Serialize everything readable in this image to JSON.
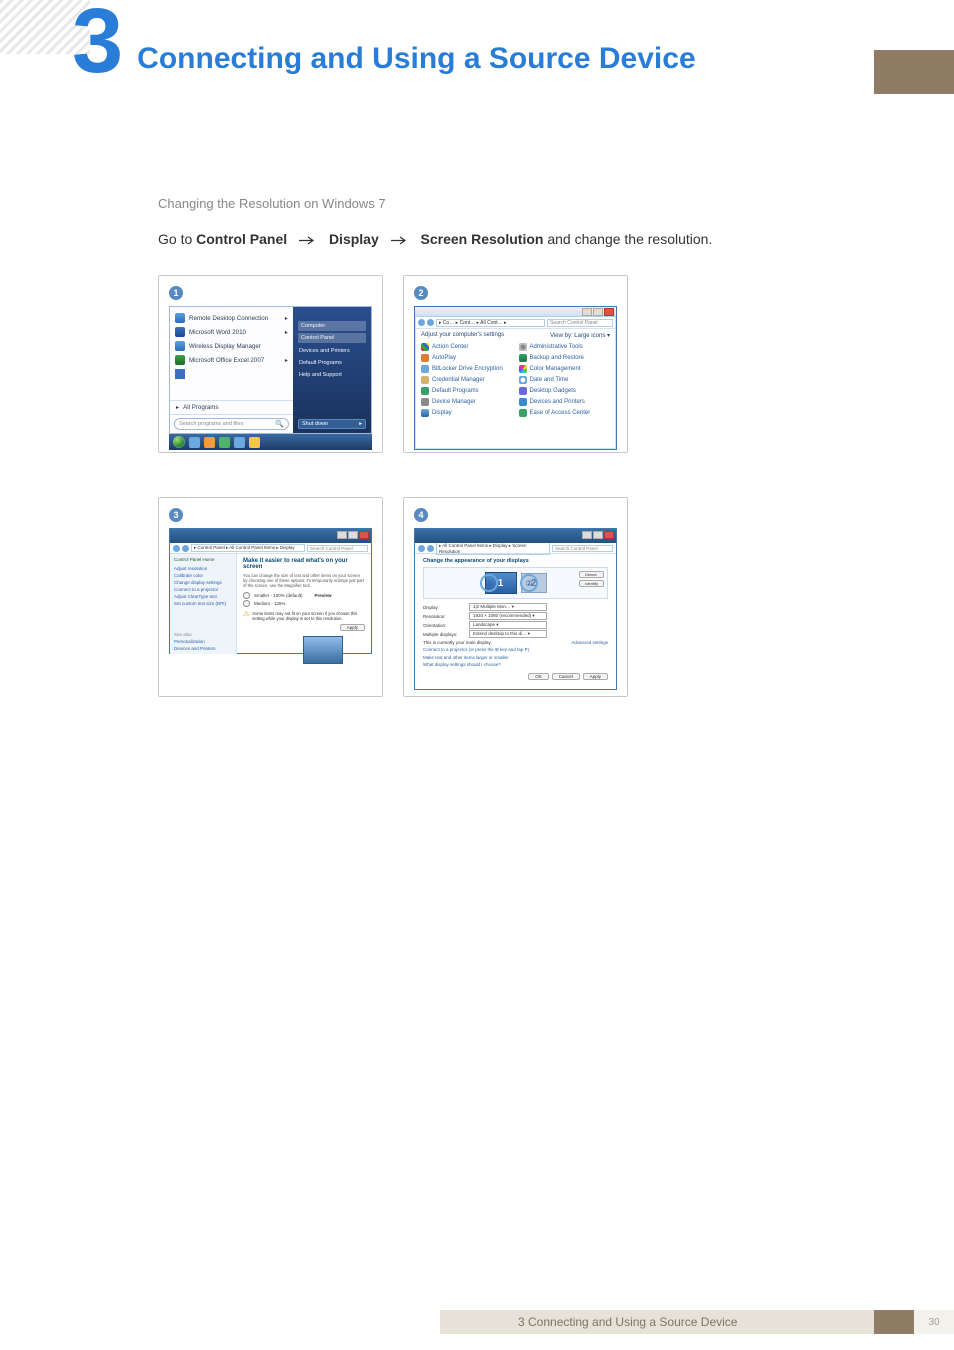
{
  "chapter": {
    "number": "3",
    "title": "Connecting and Using a Source Device"
  },
  "subheading": "Changing the Resolution on Windows 7",
  "instruction": {
    "prefix": "Go to ",
    "s1": "Control Panel",
    "s2": "Display",
    "s3": "Screen Resolution",
    "suffix": " and change the resolution."
  },
  "steps": {
    "one": "1",
    "two": "2",
    "three": "3",
    "four": "4"
  },
  "startmenu": {
    "items": [
      "Remote Desktop Connection",
      "Microsoft Word 2010",
      "Wireless Display Manager",
      "Microsoft Office Excel 2007"
    ],
    "all_programs": "All Programs",
    "search_placeholder": "Search programs and files",
    "right": [
      "Computer",
      "Control Panel",
      "Devices and Printers",
      "Default Programs",
      "Help and Support"
    ],
    "shutdown": "Shut down"
  },
  "cpanel": {
    "addr": "▸ Co… ▸ Cont… ▸ All Cont… ▸",
    "search": "Search Control Panel",
    "adjust": "Adjust your computer's settings",
    "view": "View by:  Large icons ▾",
    "items_l": [
      "Action Center",
      "AutoPlay",
      "BitLocker Drive Encryption",
      "Credential Manager",
      "Default Programs",
      "Device Manager",
      "Display"
    ],
    "items_r": [
      "Administrative Tools",
      "Backup and Restore",
      "Color Management",
      "Date and Time",
      "Desktop Gadgets",
      "Devices and Printers",
      "Ease of Access Center"
    ]
  },
  "dpanel": {
    "addr": "▸ Control Panel ▸ All Control Panel Items ▸ Display",
    "search": "Search Control Panel",
    "side_head": "Control Panel Home",
    "side": [
      "Adjust resolution",
      "Calibrate color",
      "Change display settings",
      "Connect to a projector",
      "Adjust ClearType text",
      "Set custom text size (DPI)"
    ],
    "side_also": "See also",
    "side_also_items": [
      "Personalization",
      "Devices and Printers"
    ],
    "title": "Make it easier to read what's on your screen",
    "desc": "You can change the size of text and other items on your screen by choosing one of these options. To temporarily enlarge just part of the screen, use the Magnifier tool.",
    "opt1": "Smaller - 100% (default)",
    "opt1_note": "Preview",
    "opt2": "Medium - 125%",
    "warn": "Some items may not fit on your screen if you choose this setting while your display is set to this resolution.",
    "apply": "Apply"
  },
  "rpanel": {
    "addr": "▸ All Control Panel Items ▸ Display ▸ Screen Resolution",
    "title": "Change the appearance of your displays",
    "detect": "Detect",
    "identify": "Identify",
    "rows": {
      "display": {
        "lbl": "Display:",
        "val": "1|2 Multiple Mon… ▾"
      },
      "resolution": {
        "lbl": "Resolution:",
        "val": "1920 × 1080 (recommended) ▾"
      },
      "orientation": {
        "lbl": "Orientation:",
        "val": "Landscape ▾"
      },
      "multi": {
        "lbl": "Multiple displays:",
        "val": "Extend desktop to this di… ▾"
      }
    },
    "main_note": "This is currently your main display.",
    "adv": "Advanced settings",
    "link1": "Connect to a projector (or press the ⊞ key and tap P)",
    "link2": "Make text and other items larger or smaller",
    "link3": "What display settings should I choose?",
    "ok": "OK",
    "cancel": "Cancel",
    "apply": "Apply"
  },
  "footer": {
    "caption": "3 Connecting and Using a Source Device",
    "page": "30"
  }
}
